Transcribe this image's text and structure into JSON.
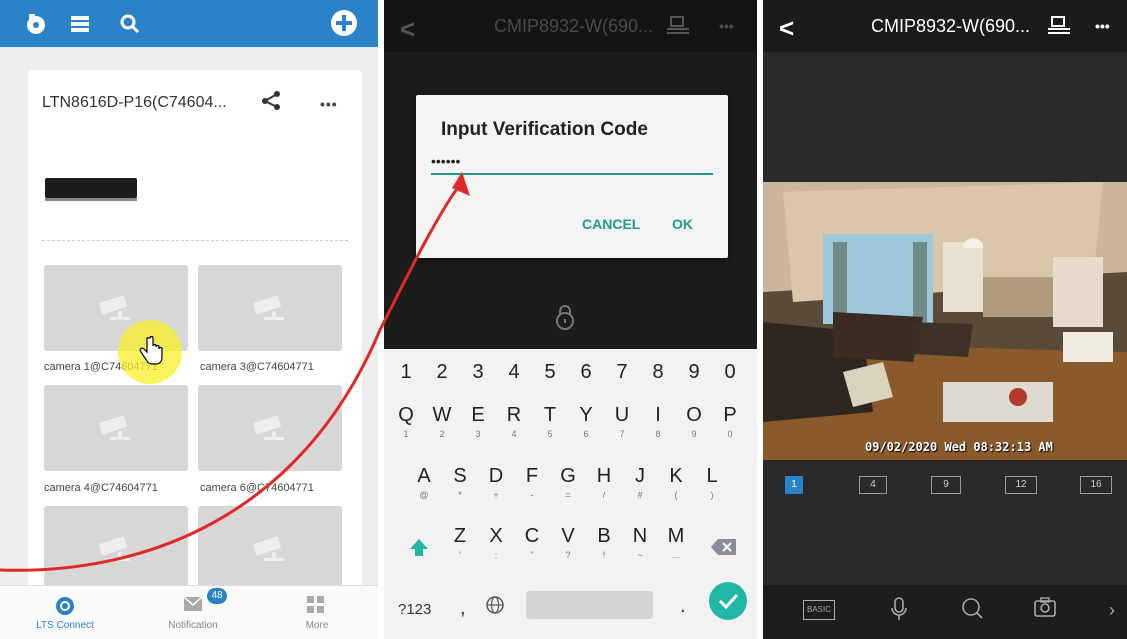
{
  "lts_panel": {
    "card": {
      "device_name": "LTN8616D-P16(C74604...",
      "more_label": "•••"
    },
    "cameras": [
      {
        "label": "camera 1@C74604771"
      },
      {
        "label": "camera 3@C74604771"
      },
      {
        "label": "camera 4@C74604771"
      },
      {
        "label": "camera 6@C74604771"
      }
    ],
    "bottom_nav": {
      "items": [
        {
          "label": "LTS Connect",
          "icon": "lts-connect-icon",
          "active": true
        },
        {
          "label": "Notification",
          "icon": "mail-icon"
        },
        {
          "label": "More",
          "icon": "grid-icon"
        }
      ],
      "notification_badge": "48"
    },
    "colors": {
      "brand": "#2b83c7"
    }
  },
  "verify_panel": {
    "header": {
      "device_title": "CMIP8932-W(690...",
      "more_label": "•••"
    },
    "dialog": {
      "title": "Input Verification Code",
      "input_value": "••••••",
      "cancel_label": "CANCEL",
      "ok_label": "OK"
    },
    "keyboard": {
      "numbers": [
        "1",
        "2",
        "3",
        "4",
        "5",
        "6",
        "7",
        "8",
        "9",
        "0"
      ],
      "row1": [
        {
          "k": "Q",
          "s": "1"
        },
        {
          "k": "W",
          "s": "2"
        },
        {
          "k": "E",
          "s": "3"
        },
        {
          "k": "R",
          "s": "4"
        },
        {
          "k": "T",
          "s": "5"
        },
        {
          "k": "Y",
          "s": "6"
        },
        {
          "k": "U",
          "s": "7"
        },
        {
          "k": "I",
          "s": "8"
        },
        {
          "k": "O",
          "s": "9"
        },
        {
          "k": "P",
          "s": "0"
        }
      ],
      "row2": [
        {
          "k": "A",
          "s": "@"
        },
        {
          "k": "S",
          "s": "*"
        },
        {
          "k": "D",
          "s": "+"
        },
        {
          "k": "F",
          "s": "-"
        },
        {
          "k": "G",
          "s": "="
        },
        {
          "k": "H",
          "s": "/"
        },
        {
          "k": "J",
          "s": "#"
        },
        {
          "k": "K",
          "s": "("
        },
        {
          "k": "L",
          "s": ")"
        }
      ],
      "row3": [
        {
          "k": "Z",
          "s": "'"
        },
        {
          "k": "X",
          "s": ":"
        },
        {
          "k": "C",
          "s": "\""
        },
        {
          "k": "V",
          "s": "?"
        },
        {
          "k": "B",
          "s": "!"
        },
        {
          "k": "N",
          "s": "~"
        },
        {
          "k": "M",
          "s": "…"
        }
      ],
      "symbols_label": "?123",
      "comma_label": ",",
      "period_label": "."
    },
    "colors": {
      "accent": "#1f9b8b"
    }
  },
  "live_panel": {
    "header": {
      "device_title": "CMIP8932-W(690...",
      "more_label": "•••"
    },
    "video": {
      "osd_timestamp": "09/02/2020 Wed 08:32:13 AM"
    },
    "split_options": [
      "1",
      "4",
      "9",
      "12",
      "16"
    ],
    "active_split": "1",
    "toolbar": {
      "basic_label": "BASIC",
      "icons": [
        "microphone-icon",
        "search-zoom-icon",
        "snapshot-icon",
        "chevron-right-icon"
      ]
    }
  }
}
